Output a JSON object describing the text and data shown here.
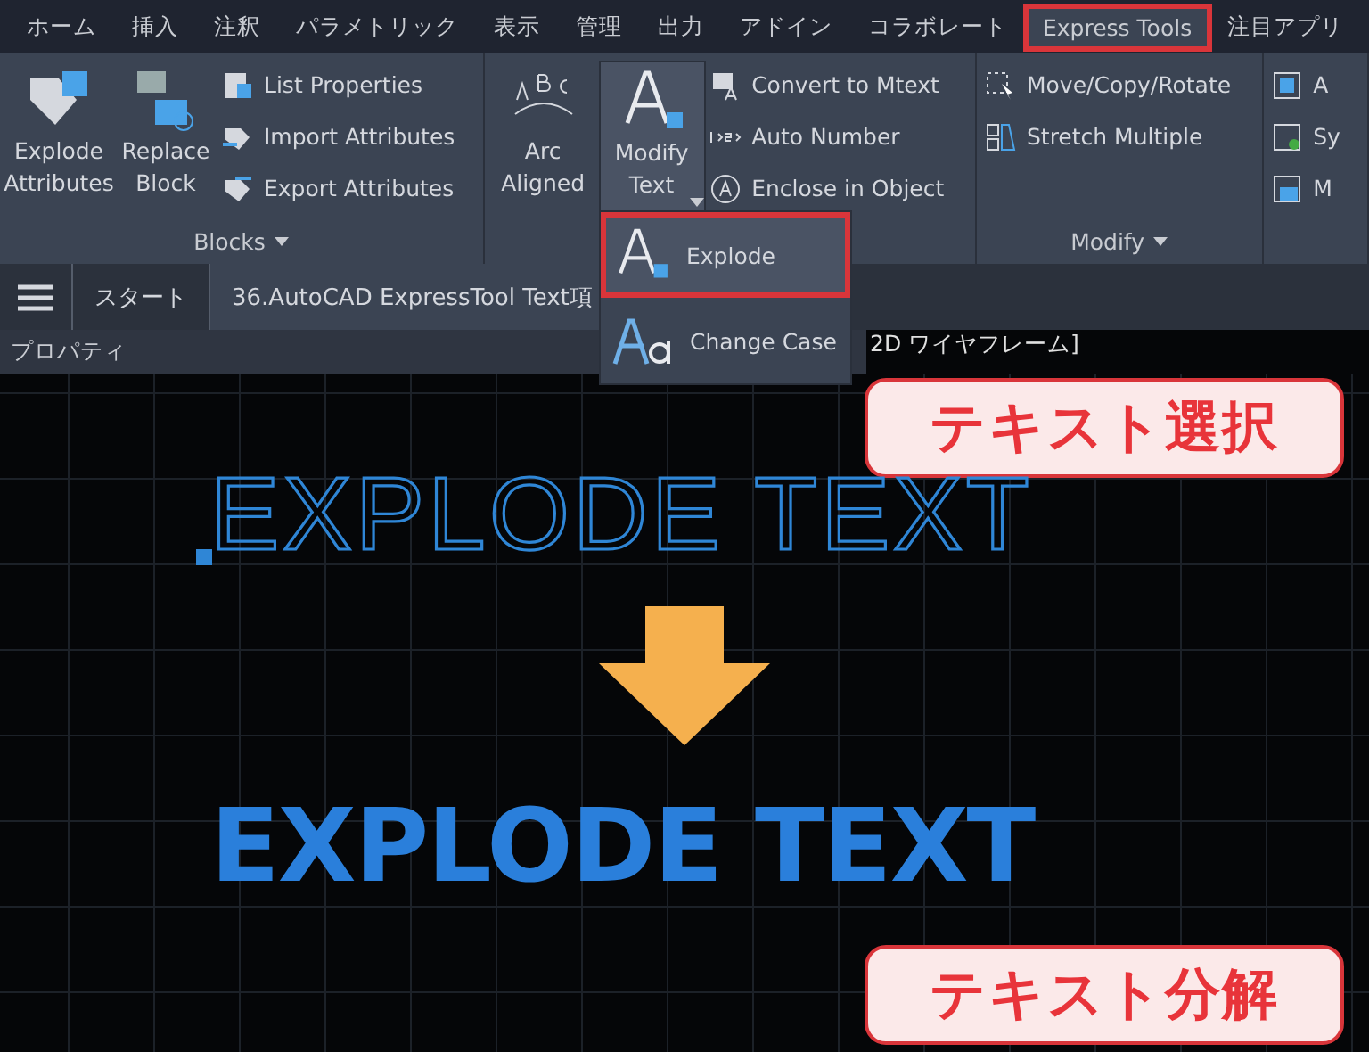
{
  "menu_tabs": [
    {
      "label": "ホーム",
      "selected": false
    },
    {
      "label": "挿入",
      "selected": false
    },
    {
      "label": "注釈",
      "selected": false
    },
    {
      "label": "パラメトリック",
      "selected": false
    },
    {
      "label": "表示",
      "selected": false
    },
    {
      "label": "管理",
      "selected": false
    },
    {
      "label": "出力",
      "selected": false
    },
    {
      "label": "アドイン",
      "selected": false
    },
    {
      "label": "コラボレート",
      "selected": false
    },
    {
      "label": "Express Tools",
      "selected": true
    },
    {
      "label": "注目アプリ",
      "selected": false
    }
  ],
  "ribbon": {
    "panels": [
      {
        "title": "Blocks",
        "large": [
          {
            "label": "Explode Attributes",
            "pressed": false
          },
          {
            "label": "Replace Block",
            "pressed": false
          }
        ],
        "small": [
          "List Properties",
          "Import Attributes",
          "Export Attributes"
        ]
      },
      {
        "large": [
          {
            "label": "Arc Aligned",
            "pressed": false
          },
          {
            "label": "Modify Text",
            "pressed": true
          }
        ],
        "small": [
          "Convert to Mtext",
          "Auto Number",
          "Enclose in Object"
        ]
      },
      {
        "title": "Modify",
        "small": [
          "Move/Copy/Rotate",
          "Stretch Multiple"
        ]
      },
      {
        "small": [
          "A",
          "Sy",
          "M"
        ]
      }
    ]
  },
  "dropdown": [
    {
      "label": "Explode",
      "selected": true
    },
    {
      "label": "Change Case",
      "selected": false
    }
  ],
  "doc_tabs": [
    {
      "label": "スタート",
      "selected": false
    },
    {
      "label": "36.AutoCAD ExpressTool Text項",
      "selected": true
    }
  ],
  "properties_palette": {
    "title": "プロパティ"
  },
  "viewport_label": "2D ワイヤフレーム]",
  "canvas": {
    "original_text": "EXPLODE TEXT",
    "exploded_text": "EXPLODE TEXT",
    "captions": [
      "テキスト選択",
      "テキスト分解"
    ]
  }
}
